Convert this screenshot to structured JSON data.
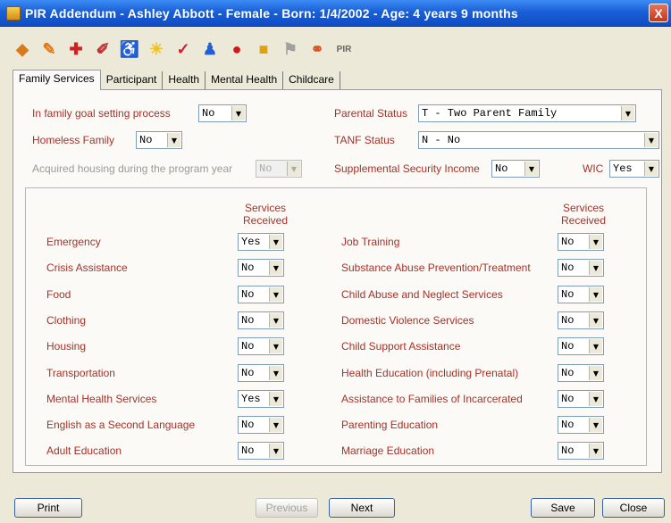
{
  "window": {
    "title": "PIR Addendum  -  Ashley Abbott  -  Female  -  Born: 1/4/2002  -  Age: 4 years 9 months",
    "close": "X"
  },
  "toolbar": {
    "pir_label": "PIR"
  },
  "tabs": [
    "Family Services",
    "Participant",
    "Health",
    "Mental Health",
    "Childcare"
  ],
  "top_fields": {
    "goal_label": "In family goal setting process",
    "goal_value": "No",
    "homeless_label": "Homeless Family",
    "homeless_value": "No",
    "housing_label": "Acquired housing during the program year",
    "housing_value": "No",
    "parental_label": "Parental Status",
    "parental_value": "T - Two Parent Family",
    "tanf_label": "TANF Status",
    "tanf_value": "N - No",
    "ssi_label": "Supplemental Security Income",
    "ssi_value": "No",
    "wic_label": "WIC",
    "wic_value": "Yes"
  },
  "services_header": "Services Received",
  "services_left": [
    {
      "label": "Emergency",
      "value": "Yes"
    },
    {
      "label": "Crisis Assistance",
      "value": "No"
    },
    {
      "label": "Food",
      "value": "No"
    },
    {
      "label": "Clothing",
      "value": "No"
    },
    {
      "label": "Housing",
      "value": "No"
    },
    {
      "label": "Transportation",
      "value": "No"
    },
    {
      "label": "Mental Health Services",
      "value": "Yes"
    },
    {
      "label": "English as a Second Language",
      "value": "No"
    },
    {
      "label": "Adult Education",
      "value": "No"
    }
  ],
  "services_right": [
    {
      "label": "Job Training",
      "value": "No"
    },
    {
      "label": "Substance Abuse Prevention/Treatment",
      "value": "No"
    },
    {
      "label": "Child Abuse and Neglect Services",
      "value": "No"
    },
    {
      "label": "Domestic Violence Services",
      "value": "No"
    },
    {
      "label": "Child Support Assistance",
      "value": "No"
    },
    {
      "label": "Health Education (including Prenatal)",
      "value": "No"
    },
    {
      "label": "Assistance to Families of Incarcerated",
      "value": "No"
    },
    {
      "label": "Parenting Education",
      "value": "No"
    },
    {
      "label": "Marriage Education",
      "value": "No"
    }
  ],
  "buttons": {
    "print": "Print",
    "previous": "Previous",
    "next": "Next",
    "save": "Save",
    "close": "Close"
  }
}
